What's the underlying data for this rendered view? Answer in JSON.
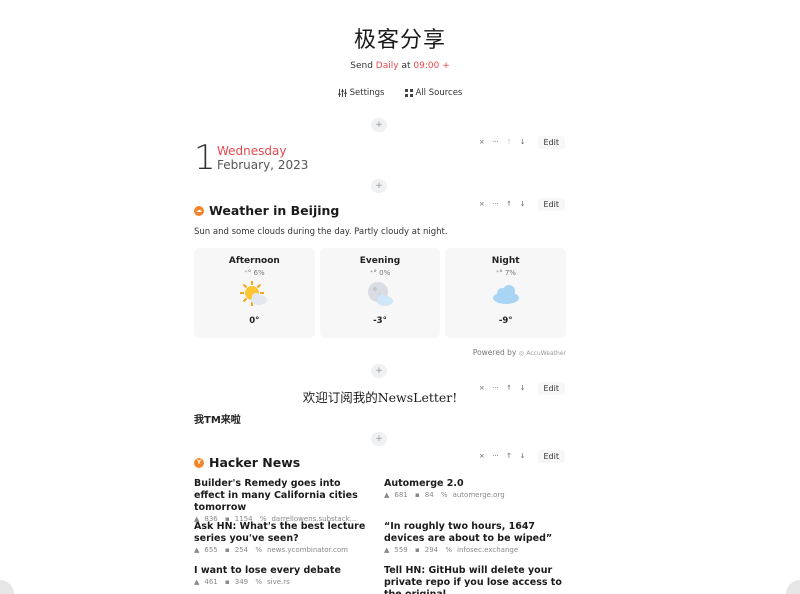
{
  "header": {
    "title": "极客分享",
    "send_prefix": "Send",
    "send_freq": "Daily",
    "send_at": "at",
    "send_time": "09:00",
    "send_plus": "+"
  },
  "toolbar": {
    "settings_label": "Settings",
    "sources_label": "All Sources"
  },
  "block_tools": {
    "close": "×",
    "more": "···",
    "up": "↑",
    "down": "↓",
    "edit": "Edit",
    "add": "+"
  },
  "date": {
    "day": "1",
    "weekday": "Wednesday",
    "month_year": "February, 2023"
  },
  "weather": {
    "title": "Weather in Beijing",
    "description": "Sun and some clouds during the day. Partly cloudy at night.",
    "periods": [
      {
        "name": "Afternoon",
        "precip": "6%",
        "temp": "0°",
        "icon": "partly-sunny-icon"
      },
      {
        "name": "Evening",
        "precip": "0%",
        "temp": "-3°",
        "icon": "moon-cloud-icon"
      },
      {
        "name": "Night",
        "precip": "7%",
        "temp": "-9°",
        "icon": "cloud-icon"
      }
    ],
    "powered_by": "Powered by",
    "provider": "AccuWeather"
  },
  "welcome": {
    "text": "欢迎订阅我的NewsLetter!",
    "sub": "我TM来啦"
  },
  "hacker_news": {
    "title": "Hacker News",
    "items": [
      {
        "title": "Builder's Remedy goes into effect in many California cities tomorrow",
        "points": "836",
        "comments": "1154",
        "domain": "darrellowens.substack..."
      },
      {
        "title": "Automerge 2.0",
        "points": "681",
        "comments": "84",
        "domain": "automerge.org"
      },
      {
        "title": "Ask HN: What's the best lecture series you've seen?",
        "points": "655",
        "comments": "254",
        "domain": "news.ycombinator.com"
      },
      {
        "title": "“In roughly two hours, 1647 devices are about to be wiped”",
        "points": "559",
        "comments": "294",
        "domain": "infosec.exchange"
      },
      {
        "title": "I want to lose every debate",
        "points": "461",
        "comments": "349",
        "domain": "sive.rs"
      },
      {
        "title": "Tell HN: GitHub will delete your private repo if you lose access to the original",
        "points": "",
        "comments": "",
        "domain": ""
      }
    ]
  },
  "colors": {
    "accent_red": "#e5484d",
    "brand_orange": "#f4862a"
  }
}
